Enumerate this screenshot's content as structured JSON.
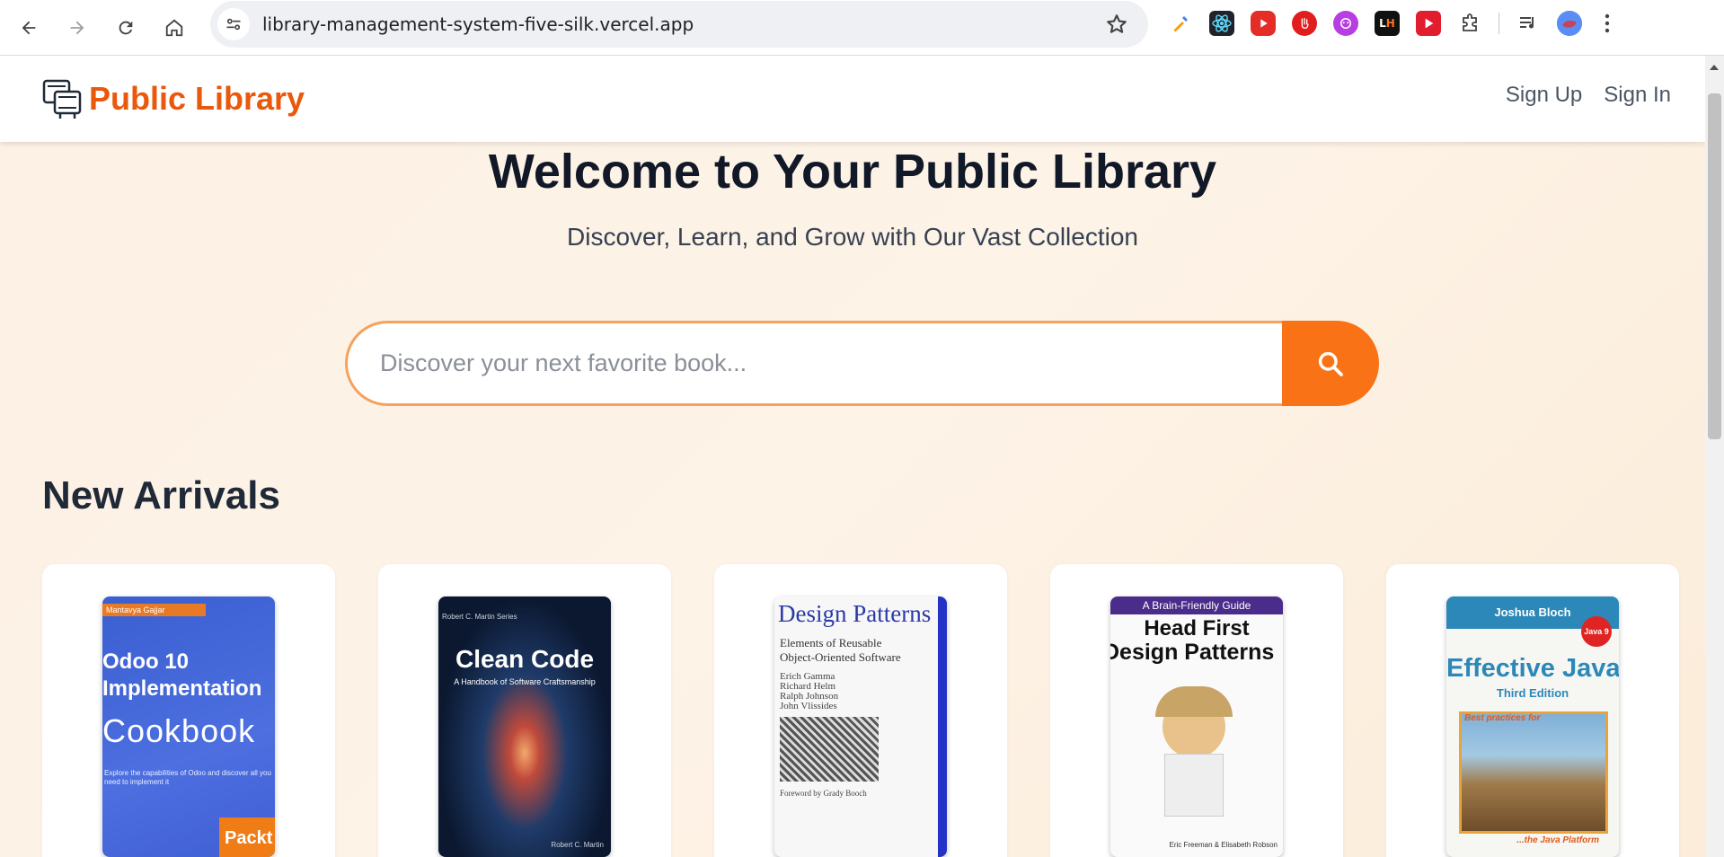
{
  "browser": {
    "url": "library-management-system-five-silk.vercel.app",
    "extensions": [
      "color-picker-icon",
      "react-devtools-icon",
      "youtube-icon",
      "stop-icon",
      "bot-icon",
      "lighthouse-icon",
      "video-icon",
      "puzzle-icon",
      "media-icon",
      "profile-avatar-icon"
    ]
  },
  "navbar": {
    "brand": "Public Library",
    "sign_up": "Sign Up",
    "sign_in": "Sign In"
  },
  "hero": {
    "title": "Welcome to Your Public Library",
    "subtitle": "Discover, Learn, and Grow with Our Vast Collection"
  },
  "search": {
    "placeholder": "Discover your next favorite book..."
  },
  "section": {
    "title": "New Arrivals"
  },
  "books": [
    {
      "author": "Mantavya Gajjar",
      "title1": "Odoo 10",
      "title2": "Implementation",
      "title3": "Cookbook",
      "blurb": "Explore the capabilities of Odoo and discover all you need to implement it",
      "publisher": "Packt"
    },
    {
      "series": "Robert C. Martin Series",
      "title": "Clean Code",
      "subtitle": "A Handbook of Software Craftsmanship",
      "author": "Robert C. Martin"
    },
    {
      "title": "Design Patterns",
      "subtitle1": "Elements of Reusable",
      "subtitle2": "Object-Oriented Software",
      "authors": [
        "Erich Gamma",
        "Richard Helm",
        "Ralph Johnson",
        "John Vlissides"
      ],
      "foreword": "Foreword by Grady Booch"
    },
    {
      "tag": "A Brain-Friendly Guide",
      "title1": "Head First",
      "title2": "Design Patterns",
      "authors": "Eric Freeman & Elisabeth Robson"
    },
    {
      "author": "Joshua Bloch",
      "title": "Effective Java",
      "edition": "Third Edition",
      "tagline": "Best practices for",
      "platform": "...the Java Platform",
      "badge": "Java 9"
    }
  ],
  "colors": {
    "brand": "#ea580c",
    "accent": "#f97316",
    "title": "#111827"
  }
}
